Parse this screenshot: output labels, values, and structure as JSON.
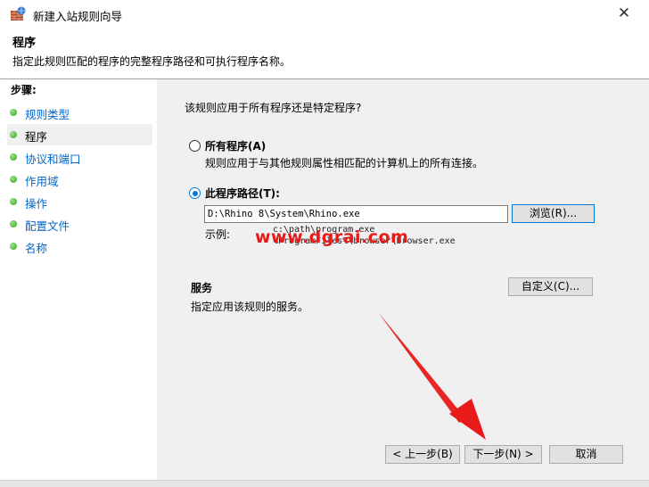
{
  "window": {
    "title": "新建入站规则向导",
    "close_glyph": "✕"
  },
  "header": {
    "title": "程序",
    "description": "指定此规则匹配的程序的完整程序路径和可执行程序名称。"
  },
  "sidebar": {
    "title": "步骤:",
    "items": [
      {
        "label": "规则类型",
        "active": false
      },
      {
        "label": "程序",
        "active": true
      },
      {
        "label": "协议和端口",
        "active": false
      },
      {
        "label": "作用域",
        "active": false
      },
      {
        "label": "操作",
        "active": false
      },
      {
        "label": "配置文件",
        "active": false
      },
      {
        "label": "名称",
        "active": false
      }
    ]
  },
  "main": {
    "question": "该规则应用于所有程序还是特定程序?",
    "all_programs": {
      "label": "所有程序(A)",
      "description": "规则应用于与其他规则属性相匹配的计算机上的所有连接。",
      "checked": false
    },
    "this_program": {
      "label": "此程序路径(T):",
      "checked": true,
      "path_value": "D:\\Rhino 8\\System\\Rhino.exe",
      "browse_label": "浏览(R)...",
      "example_label": "示例:",
      "example_line1": "c:\\path\\program.exe",
      "example_line2": "%ProgramFiles%\\browser\\browser.exe"
    },
    "services": {
      "title": "服务",
      "description": "指定应用该规则的服务。",
      "customize_label": "自定义(C)..."
    },
    "watermark": "www.dgrai.com"
  },
  "footer": {
    "back_label": "< 上一步(B)",
    "next_label": "下一步(N) >",
    "cancel_label": "取消"
  },
  "colors": {
    "link": "#0066cc",
    "radio_accent": "#0078d7",
    "annotation_arrow": "#e81a1a"
  }
}
